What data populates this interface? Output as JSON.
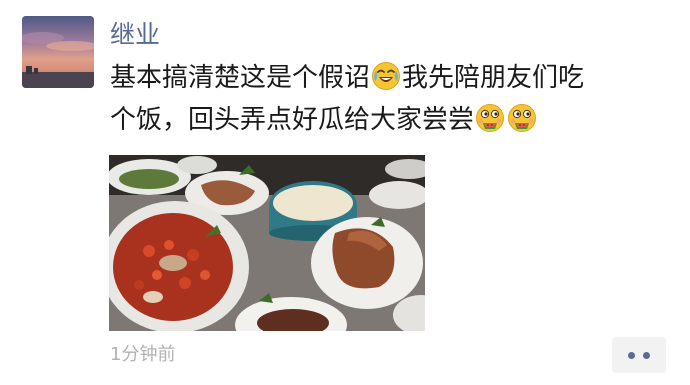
{
  "post": {
    "author": "继业",
    "content_line1_text": "基本搞清楚这是个假诏",
    "content_line1_emoji": "crying-laughing-emoji",
    "content_line1_tail": "我先陪朋友们吃",
    "content_line2_text": "个饭，回头弄点好瓜给大家尝尝",
    "content_line2_emojis": [
      "eating-melon-emoji",
      "eating-melon-emoji"
    ],
    "photo": "food-table-photo",
    "time": "1分钟前",
    "more_icon": "two-dots-icon"
  },
  "colors": {
    "author_name": "#576b95",
    "text": "#1a1a1a",
    "timestamp": "#b2b2b2",
    "more_button_bg": "#f2f2f2"
  }
}
